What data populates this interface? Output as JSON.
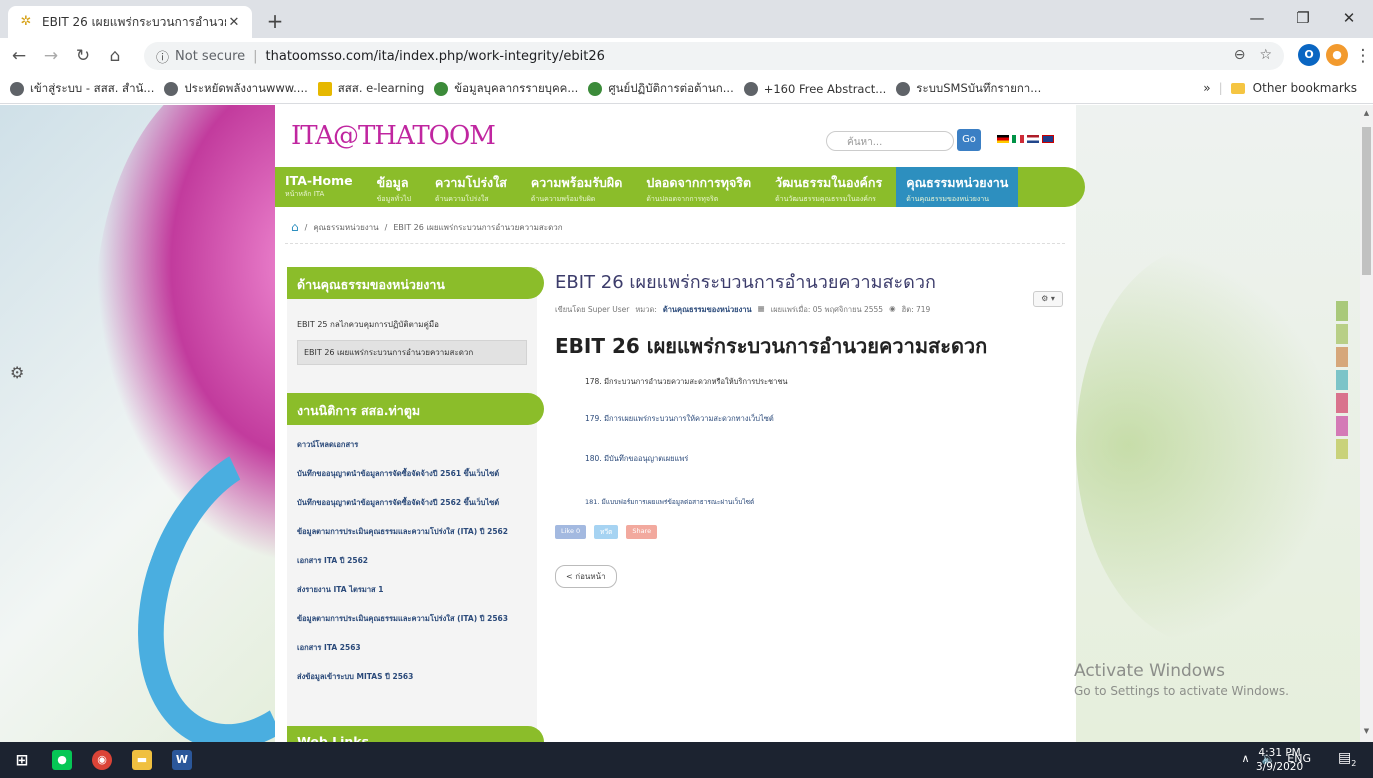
{
  "browser": {
    "tab_title": "EBIT 26 เผยแพร่กระบวนการอำนวยค",
    "new_tab": "+",
    "not_secure": "Not secure",
    "url": "thatoomsso.com/ita/index.php/work-integrity/ebit26",
    "bookmarks": [
      "เข้าสู่ระบบ - สสส. สำนั...",
      "ประหยัดพลังงานwww....",
      "สสส. e-learning",
      "ข้อมูลบุคลากรรายบุคค...",
      "ศูนย์ปฏิบัติการต่อต้านก...",
      "+160 Free Abstract...",
      "ระบบSMSบันทึกรายกา..."
    ],
    "more_bookmarks": "»",
    "other_bookmarks": "Other bookmarks"
  },
  "site": {
    "logo": "ITA@THATOOM",
    "search_placeholder": "ค้นหา...",
    "go_label": "Go",
    "nav": [
      {
        "main": "ITA-Home",
        "sub": "หน้าหลัก ITA"
      },
      {
        "main": "ข้อมูล",
        "sub": "ข้อมูลทั่วไป"
      },
      {
        "main": "ความโปร่งใส",
        "sub": "ด้านความโปร่งใส"
      },
      {
        "main": "ความพร้อมรับผิด",
        "sub": "ด้านความพร้อมรับผิด"
      },
      {
        "main": "ปลอดจากการทุจริต",
        "sub": "ด้านปลอดจากการทุจริต"
      },
      {
        "main": "วัฒนธรรมในองค์กร",
        "sub": "ด้านวัฒนธรรมคุณธรรมในองค์กร"
      },
      {
        "main": "คุณธรรมหน่วยงาน",
        "sub": "ด้านคุณธรรมของหน่วยงาน"
      }
    ],
    "breadcrumb": [
      "คุณธรรมหน่วยงาน",
      "EBIT 26 เผยแพร่กระบวนการอำนวยความสะดวก"
    ],
    "breadcrumb_sep": "/"
  },
  "sidebar": {
    "section1_title": "ด้านคุณธรรมของหน่วยงาน",
    "section1_items": [
      "EBIT 25 กลไกควบคุมการปฏิบัติตามคู่มือ",
      "EBIT 26 เผยแพร่กระบวนการอำนวยความสะดวก"
    ],
    "section2_title": "งานนิติการ สสอ.ท่าตูม",
    "section2_items": [
      "ดาวน์โหลดเอกสาร",
      "บันทึกขออนุญาตนำข้อมูลการจัดซื้อจัดจ้างปี 2561 ขึ้นเว็บไซต์",
      "บันทึกขออนุญาตนำข้อมูลการจัดซื้อจัดจ้างปี 2562 ขึ้นเว็บไซต์",
      "ข้อมูลตามการประเมินคุณธรรมและความโปร่งใส (ITA) ปี 2562",
      "เอกสาร ITA ปี 2562",
      "ส่งรายงาน ITA ไตรมาส 1",
      "ข้อมูลตามการประเมินคุณธรรมและความโปร่งใส (ITA) ปี 2563",
      "เอกสาร ITA 2563",
      "ส่งข้อมูลเข้าระบบ MITAS ปี 2563"
    ],
    "section3_title": "Web Links"
  },
  "article": {
    "title": "EBIT 26 เผยแพร่กระบวนการอำนวยความสะดวก",
    "author": "เขียนโดย Super User",
    "category_label": "หมวด:",
    "category": "ด้านคุณธรรมของหน่วยงาน",
    "published": "เผยแพร่เมื่อ: 05 พฤศจิกายน 2555",
    "hits": "ฮิต: 719",
    "tools": "⚙ ▾",
    "heading": "EBIT 26 เผยแพร่กระบวนการอำนวยความสะดวก",
    "items": [
      "178. มีกระบวนการอำนวยความสะดวกหรือให้บริการประชาชน",
      "179. มีการเผยแพร่กระบวนการให้ความสะดวกทางเว็บไซต์",
      "180. มีบันทึกขออนุญาตเผยแพร่",
      "181. มีแบบฟอร์มการเผยแพร่ข้อมูลต่อสาธารณะผ่านเว็บไซต์"
    ],
    "social": [
      "Like 0",
      "ทวีต",
      "Share"
    ],
    "prev_button": "< ก่อนหน้า"
  },
  "watermark": {
    "line1": "Activate Windows",
    "line2": "Go to Settings to activate Windows."
  },
  "taskbar": {
    "lang": "ENG",
    "time": "4:31 PM",
    "date": "3/9/2020",
    "notifications": "2"
  }
}
